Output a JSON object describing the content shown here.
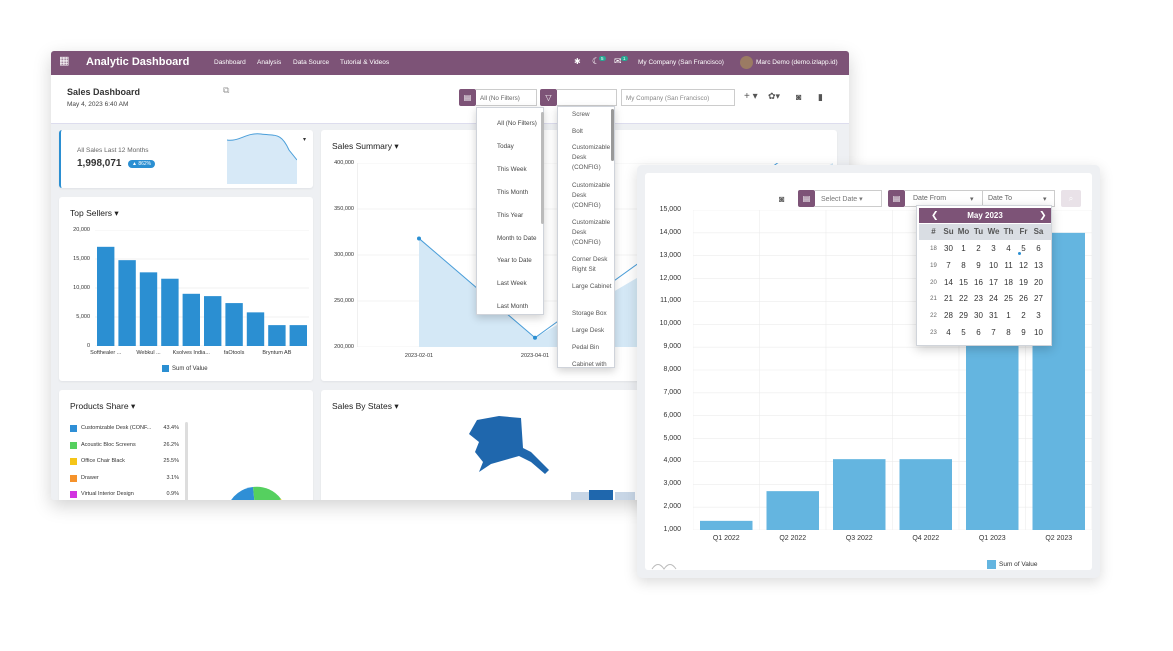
{
  "app": {
    "title": "Analytic Dashboard",
    "menu": [
      "Dashboard",
      "Analysis",
      "Data Source",
      "Tutorial & Videos"
    ],
    "chat_count": "5",
    "activity_count": "1",
    "company": "My Company (San Francisco)",
    "user": "Marc Demo (demo.izlapp.id)"
  },
  "dashboard": {
    "title": "Sales Dashboard",
    "date": "May 4, 2023 6:40 AM",
    "filter_value": "All (No Filters)",
    "company_placeholder": "My Company (San Francisco)",
    "add_label": "+"
  },
  "period_options": [
    "All (No Filters)",
    "Today",
    "This Week",
    "This Month",
    "This Year",
    "Month to Date",
    "Year to Date",
    "Last Week",
    "Last Month"
  ],
  "product_options": [
    "Screw",
    "Bolt",
    "Customizable Desk (CONFIG)",
    "Customizable Desk (CONFIG)",
    "Customizable Desk (CONFIG)",
    "Corner Desk Right Sit",
    "Large Cabinet",
    "Storage Box",
    "Large Desk",
    "Pedal Bin",
    "Cabinet with"
  ],
  "kpi": {
    "label": "All Sales Last 12 Months",
    "value": "1,998,071",
    "badge": "▲ 862%"
  },
  "top_sellers": {
    "title": "Top Sellers",
    "legend": "Sum of Value"
  },
  "sales_summary": {
    "title": "Sales Summary"
  },
  "products_share": {
    "title": "Products Share",
    "items": [
      {
        "name": "Customizable Desk (CONF...",
        "pct": "43.4%",
        "color": "#2f8fd6"
      },
      {
        "name": "Acoustic Bloc Screens",
        "pct": "26.2%",
        "color": "#55d05f"
      },
      {
        "name": "Office Chair Black",
        "pct": "25.5%",
        "color": "#f5c518"
      },
      {
        "name": "Drawer",
        "pct": "3.1%",
        "color": "#f5922b"
      },
      {
        "name": "Virtual Interior Design",
        "pct": "0.9%",
        "color": "#d234e0"
      }
    ]
  },
  "sales_states": {
    "title": "Sales By States"
  },
  "date_filter": {
    "select_label": "Select Date",
    "from_label": "Date From",
    "to_label": "Date To"
  },
  "calendar": {
    "month": "May 2023",
    "headers": [
      "#",
      "Su",
      "Mo",
      "Tu",
      "We",
      "Th",
      "Fr",
      "Sa"
    ],
    "weeks": [
      [
        "18",
        "30",
        "1",
        "2",
        "3",
        "4",
        "5",
        "6"
      ],
      [
        "19",
        "7",
        "8",
        "9",
        "10",
        "11",
        "12",
        "13"
      ],
      [
        "20",
        "14",
        "15",
        "16",
        "17",
        "18",
        "19",
        "20"
      ],
      [
        "21",
        "21",
        "22",
        "23",
        "24",
        "25",
        "26",
        "27"
      ],
      [
        "22",
        "28",
        "29",
        "30",
        "31",
        "1",
        "2",
        "3"
      ],
      [
        "23",
        "4",
        "5",
        "6",
        "7",
        "8",
        "9",
        "10"
      ]
    ]
  },
  "chart_data": [
    {
      "type": "bar",
      "title": "Top Sellers",
      "categories": [
        "Softhealer ...",
        "",
        "Webkul ...",
        "",
        "Ksolves India...",
        "",
        "faOtools",
        "",
        "Bryntum AB",
        ""
      ],
      "values": [
        17100,
        14800,
        12700,
        11600,
        9000,
        8600,
        7400,
        5800,
        3600,
        3600
      ],
      "ylim": [
        0,
        20000
      ],
      "yticks": [
        0,
        5000,
        10000,
        15000,
        20000
      ],
      "ytick_labels": [
        "0",
        "5,000",
        "10,000",
        "15,000",
        "20,000"
      ],
      "legend": [
        "Sum of Value"
      ],
      "color": "#2b8fd2"
    },
    {
      "type": "area",
      "title": "Sales Summary",
      "x": [
        "2023-02-01",
        "2023-04-01"
      ],
      "points": [
        {
          "x": "2023-02-01",
          "y": 318000
        },
        {
          "x": "2023-04-01",
          "y": 210000
        }
      ],
      "ylim": [
        200000,
        400000
      ],
      "yticks": [
        200000,
        250000,
        300000,
        350000,
        400000
      ],
      "ytick_labels": [
        "200,000",
        "250,000",
        "300,000",
        "350,000",
        "400,000"
      ]
    },
    {
      "type": "bar",
      "categories": [
        "Q1 2022",
        "Q2 2022",
        "Q3 2022",
        "Q4 2022",
        "Q1 2023",
        "Q2 2023"
      ],
      "values": [
        1400,
        2700,
        4100,
        4100,
        10000,
        14000
      ],
      "ylim": [
        1000,
        15000
      ],
      "yticks": [
        1000,
        2000,
        3000,
        4000,
        5000,
        6000,
        7000,
        8000,
        9000,
        10000,
        11000,
        12000,
        13000,
        14000,
        15000
      ],
      "ytick_labels": [
        "1,000",
        "2,000",
        "3,000",
        "4,000",
        "5,000",
        "6,000",
        "7,000",
        "8,000",
        "9,000",
        "10,000",
        "11,000",
        "12,000",
        "13,000",
        "14,000",
        "15,000"
      ],
      "legend": [
        "Sum of Value"
      ],
      "color": "#64b5e0"
    }
  ]
}
